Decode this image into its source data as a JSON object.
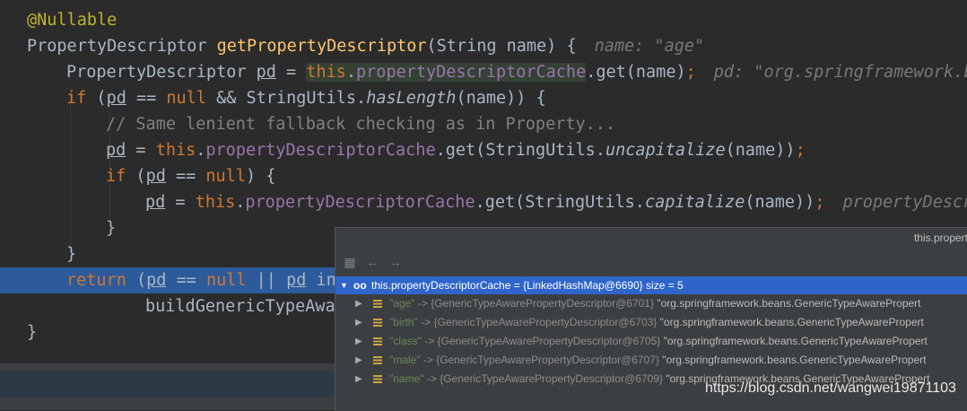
{
  "code": {
    "annotation": "@Nullable",
    "line2": {
      "type": "PropertyDescriptor ",
      "method": "getPropertyDescriptor",
      "params": "(String name) {",
      "hint": "name: \"age\""
    },
    "line3": {
      "type": "PropertyDescriptor ",
      "var": "pd",
      "eq": " = ",
      "this_kw": "this",
      "dot": ".",
      "field": "propertyDescriptorCache",
      "call": ".get(name)",
      "semi": ";",
      "hint": "pd: \"org.springframework.be"
    },
    "line4": {
      "if_kw": "if",
      "p1": " (",
      "var": "pd",
      "p2": " == ",
      "null_kw": "null",
      "p3": " && StringUtils.",
      "method": "hasLength",
      "p4": "(name)) {"
    },
    "line5": {
      "comment": "// Same lenient fallback checking as in Property..."
    },
    "line6": {
      "var": "pd",
      "p1": " = ",
      "this_kw": "this",
      "dot": ".",
      "field": "propertyDescriptorCache",
      "p2": ".get(StringUtils.",
      "method": "uncapitalize",
      "p3": "(name))",
      "semi": ";"
    },
    "line7": {
      "if_kw": "if",
      "p1": " (",
      "var": "pd",
      "p2": " == ",
      "null_kw": "null",
      "p3": ") {"
    },
    "line8": {
      "var": "pd",
      "p1": " = ",
      "this_kw": "this",
      "dot": ".",
      "field": "propertyDescriptorCache",
      "p2": ".get(StringUtils.",
      "method": "capitalize",
      "p3": "(name))",
      "semi": ";",
      "hint": "propertyDescr"
    },
    "line9": "}",
    "line10": "}",
    "line11": {
      "return_kw": "return",
      "p1": " (",
      "var": "pd",
      "p2": " == ",
      "null_kw": "null",
      "p3": " || ",
      "var2": "pd",
      "p4": " in"
    },
    "line12": "buildGenericTypeAwa",
    "line13": "}"
  },
  "debug_popup": {
    "title": "this.propert",
    "toolbar": {
      "icon_left": "database-icon",
      "icon_back": "arrow-left-icon",
      "icon_forward": "arrow-right-icon"
    },
    "root": {
      "expand_icon": "▼",
      "icon": "oo",
      "expression": "this.propertyDescriptorCache",
      "value": " = {LinkedHashMap@6690}",
      "size": "  size = 5"
    },
    "entries": [
      {
        "key": "\"age\"",
        "ref": " -> {GenericTypeAwarePropertyDescriptor@6701}",
        "value": " \"org.springframework.beans.GenericTypeAwarePropert"
      },
      {
        "key": "\"birth\"",
        "ref": " -> {GenericTypeAwarePropertyDescriptor@6703}",
        "value": " \"org.springframework.beans.GenericTypeAwarePropert"
      },
      {
        "key": "\"class\"",
        "ref": " -> {GenericTypeAwarePropertyDescriptor@6705}",
        "value": " \"org.springframework.beans.GenericTypeAwarePropert"
      },
      {
        "key": "\"male\"",
        "ref": " -> {GenericTypeAwarePropertyDescriptor@6707}",
        "value": " \"org.springframework.beans.GenericTypeAwarePropert"
      },
      {
        "key": "\"name\"",
        "ref": " -> {GenericTypeAwarePropertyDescriptor@6709}",
        "value": " \"org.springframework.beans.GenericTypeAwarePropert"
      }
    ]
  },
  "watermark": "https://blog.csdn.net/wangwei19871103",
  "colors": {
    "keyword": "#cc7832",
    "method": "#ffc66d",
    "field": "#9876aa",
    "annotation": "#bbb529",
    "selection": "#2d5a9b",
    "popup_selection": "#2f65ca"
  }
}
